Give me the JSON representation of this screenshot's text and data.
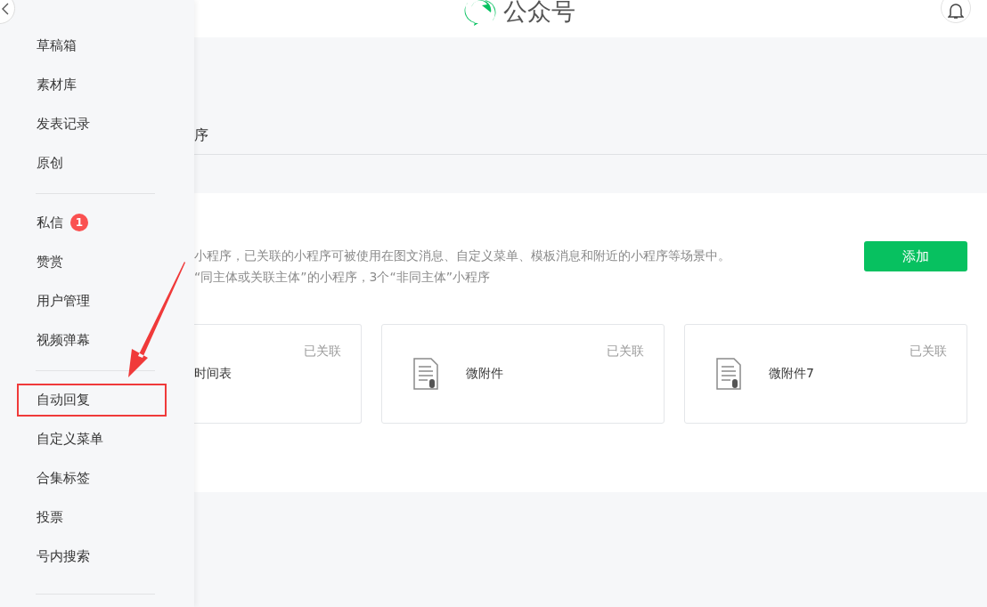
{
  "header": {
    "title": "公众号"
  },
  "sidebar": {
    "groups": [
      {
        "items": [
          {
            "label": "草稿箱",
            "highlighted": false
          },
          {
            "label": "素材库",
            "highlighted": false
          },
          {
            "label": "发表记录",
            "highlighted": false
          },
          {
            "label": "原创",
            "highlighted": false
          }
        ]
      },
      {
        "items": [
          {
            "label": "私信",
            "highlighted": false,
            "badge": "1"
          },
          {
            "label": "赞赏",
            "highlighted": false
          },
          {
            "label": "用户管理",
            "highlighted": false
          },
          {
            "label": "视频弹幕",
            "highlighted": false
          }
        ]
      },
      {
        "items": [
          {
            "label": "自动回复",
            "highlighted": true
          },
          {
            "label": "自定义菜单",
            "highlighted": false
          },
          {
            "label": "合集标签",
            "highlighted": false
          },
          {
            "label": "投票",
            "highlighted": false
          },
          {
            "label": "号内搜索",
            "highlighted": false
          }
        ]
      }
    ]
  },
  "main": {
    "tab": "序",
    "description": [
      "小程序，已关联的小程序可被使用在图文消息、自定义菜单、模板消息和附近的小程序等场景中。",
      "“同主体或关联主体”的小程序，3个“非同主体”小程序"
    ],
    "add_button": "添加",
    "cards": [
      {
        "name": "时间表",
        "status": "已关联",
        "icon": false
      },
      {
        "name": "微附件",
        "status": "已关联",
        "icon": true
      },
      {
        "name": "微附件7",
        "status": "已关联",
        "icon": true
      }
    ]
  }
}
